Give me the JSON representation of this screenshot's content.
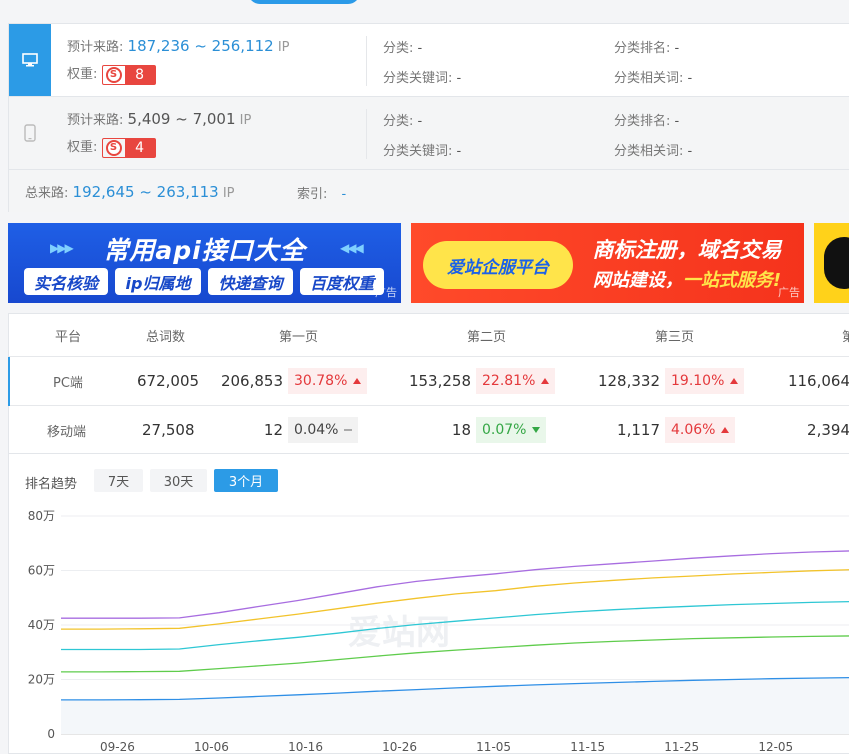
{
  "panel": {
    "pc": {
      "device_icon": "monitor-icon",
      "traffic_label": "预计来路:",
      "traffic_range": "187,236 ~ 256,112",
      "traffic_unit": "IP",
      "weight_label": "权重:",
      "weight_value": "8",
      "category_label": "分类:",
      "category_value": "-",
      "category_rank_label": "分类排名:",
      "category_rank_value": "-",
      "category_keyword_label": "分类关键词:",
      "category_keyword_value": "-",
      "category_related_label": "分类相关词:",
      "category_related_value": "-"
    },
    "mobile": {
      "device_icon": "phone-icon",
      "traffic_label": "预计来路:",
      "traffic_range": "5,409 ~ 7,001",
      "traffic_unit": "IP",
      "weight_label": "权重:",
      "weight_value": "4",
      "category_label": "分类:",
      "category_value": "-",
      "category_rank_label": "分类排名:",
      "category_rank_value": "-",
      "category_keyword_label": "分类关键词:",
      "category_keyword_value": "-",
      "category_related_label": "分类相关词:",
      "category_related_value": "-"
    },
    "total_label": "总来路:",
    "total_range": "192,645 ~ 263,113",
    "total_unit": "IP",
    "index_label": "索引:",
    "index_value": "-"
  },
  "ads": {
    "ad1": {
      "headline": "常用api接口大全",
      "pills": [
        "实名核验",
        "ip归属地",
        "快递查询",
        "百度权重"
      ],
      "tag": "广告"
    },
    "ad2": {
      "logo": "爱站企服平台",
      "line1": "商标注册，域名交易",
      "line2_prefix": "网站建设，",
      "line2_highlight": "一站式服务!",
      "tag": "广告"
    }
  },
  "table": {
    "headers": [
      "平台",
      "总词数",
      "第一页",
      "第二页",
      "第三页",
      "第"
    ],
    "rows": [
      {
        "platform": "PC端",
        "total": "672,005",
        "p1": "206,853",
        "p1_pct": "30.78%",
        "p1_dir": "up",
        "p2": "153,258",
        "p2_pct": "22.81%",
        "p2_dir": "up",
        "p3": "128,332",
        "p3_pct": "19.10%",
        "p3_dir": "up",
        "p4": "116,064"
      },
      {
        "platform": "移动端",
        "total": "27,508",
        "p1": "12",
        "p1_pct": "0.04%",
        "p1_dir": "flat",
        "p2": "18",
        "p2_pct": "0.07%",
        "p2_dir": "down",
        "p3": "1,117",
        "p3_pct": "4.06%",
        "p3_dir": "up",
        "p4": "2,394"
      }
    ]
  },
  "trend": {
    "label": "排名趋势",
    "ranges": [
      "7天",
      "30天",
      "3个月"
    ],
    "active_range": "3个月",
    "watermark": "爱站网"
  },
  "colors": {
    "accent": "#2c9be6",
    "up": "#e4393c",
    "down": "#34a745",
    "series": [
      "#a86de0",
      "#f2c32b",
      "#2ec7d4",
      "#5fcc4c",
      "#2f8fe6"
    ]
  },
  "chart_data": {
    "type": "line",
    "ylim": [
      0,
      80
    ],
    "y_ticks": [
      "0",
      "20万",
      "40万",
      "60万",
      "80万"
    ],
    "y_tick_values": [
      0,
      20,
      40,
      60,
      80
    ],
    "x_ticks": [
      "09-26",
      "10-06",
      "10-16",
      "10-26",
      "11-05",
      "11-15",
      "11-25",
      "12-05"
    ],
    "x_index_of_ticks": [
      6,
      16,
      26,
      36,
      46,
      56,
      66,
      76
    ],
    "x_count": 85,
    "grid": true,
    "legend": "none",
    "series": [
      {
        "values": [
          42.5,
          42.5,
          42.5,
          42.6,
          44.5,
          46.8,
          49.0,
          51.5,
          54.0,
          56.0,
          57.5,
          58.8,
          60.3,
          61.5,
          62.5,
          63.5,
          64.5,
          65.4,
          66.2,
          66.8,
          67.2
        ]
      },
      {
        "values": [
          38.5,
          38.5,
          38.6,
          38.8,
          40.4,
          42.2,
          44.0,
          46.0,
          48.0,
          49.8,
          51.4,
          52.6,
          54.2,
          55.4,
          56.4,
          57.3,
          58.0,
          58.7,
          59.3,
          59.9,
          60.3
        ]
      },
      {
        "values": [
          31.0,
          31.0,
          31.0,
          31.2,
          32.8,
          34.2,
          35.5,
          37.0,
          38.7,
          40.2,
          41.4,
          42.6,
          43.8,
          44.8,
          45.6,
          46.3,
          46.9,
          47.5,
          47.9,
          48.3,
          48.6
        ]
      },
      {
        "values": [
          22.8,
          22.8,
          22.9,
          23.0,
          24.0,
          25.0,
          26.0,
          27.3,
          28.6,
          29.8,
          30.8,
          31.7,
          32.6,
          33.4,
          34.0,
          34.5,
          35.0,
          35.3,
          35.6,
          35.8,
          36.0
        ]
      },
      {
        "values": [
          12.5,
          12.5,
          12.6,
          12.7,
          13.2,
          13.8,
          14.4,
          15.0,
          15.7,
          16.3,
          16.9,
          17.5,
          18.0,
          18.5,
          18.9,
          19.3,
          19.7,
          20.0,
          20.3,
          20.5,
          20.7
        ]
      }
    ]
  }
}
